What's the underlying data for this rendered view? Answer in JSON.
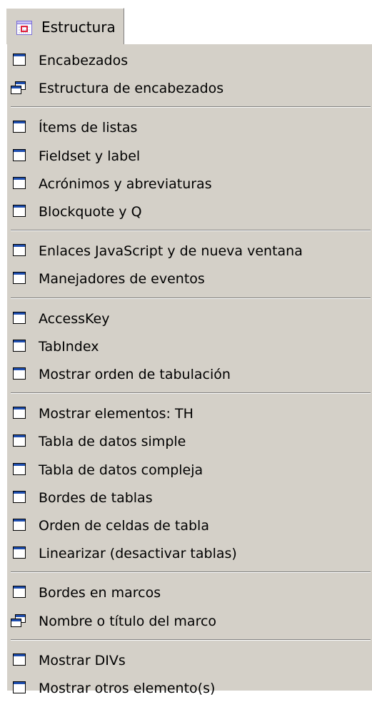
{
  "menu": {
    "title": "Estructura"
  },
  "groups": [
    {
      "items": [
        {
          "label": "Encabezados",
          "icon": "window-icon"
        },
        {
          "label": "Estructura de encabezados",
          "icon": "cascade-windows-icon"
        }
      ]
    },
    {
      "items": [
        {
          "label": "Ítems de listas",
          "icon": "window-icon"
        },
        {
          "label": "Fieldset y label",
          "icon": "window-icon"
        },
        {
          "label": "Acrónimos y abreviaturas",
          "icon": "window-icon"
        },
        {
          "label": "Blockquote y Q",
          "icon": "window-icon"
        }
      ]
    },
    {
      "items": [
        {
          "label": "Enlaces JavaScript y de nueva ventana",
          "icon": "window-icon"
        },
        {
          "label": "Manejadores de eventos",
          "icon": "window-icon"
        }
      ]
    },
    {
      "items": [
        {
          "label": "AccessKey",
          "icon": "window-icon"
        },
        {
          "label": "TabIndex",
          "icon": "window-icon"
        },
        {
          "label": "Mostrar orden de tabulación",
          "icon": "window-icon"
        }
      ]
    },
    {
      "items": [
        {
          "label": "Mostrar elementos: TH",
          "icon": "window-icon"
        },
        {
          "label": "Tabla de datos simple",
          "icon": "window-icon"
        },
        {
          "label": "Tabla de datos compleja",
          "icon": "window-icon"
        },
        {
          "label": "Bordes de tablas",
          "icon": "window-icon"
        },
        {
          "label": "Orden de celdas de tabla",
          "icon": "window-icon"
        },
        {
          "label": "Linearizar (desactivar tablas)",
          "icon": "window-icon"
        }
      ]
    },
    {
      "items": [
        {
          "label": "Bordes en marcos",
          "icon": "window-icon"
        },
        {
          "label": "Nombre o título del marco",
          "icon": "cascade-windows-icon"
        }
      ]
    },
    {
      "items": [
        {
          "label": "Mostrar DIVs",
          "icon": "window-icon"
        },
        {
          "label": "Mostrar otros elemento(s)",
          "icon": "window-icon"
        }
      ]
    }
  ],
  "colors": {
    "menu_bg": "#d4d0c8",
    "icon_titlebar": "#1f4fb0",
    "separator_dark": "#808080",
    "separator_light": "#ffffff"
  }
}
